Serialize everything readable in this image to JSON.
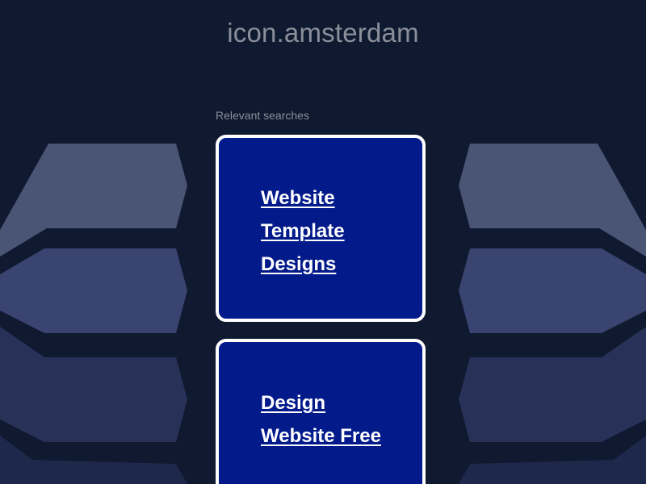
{
  "header": {
    "domain_title": "icon.amsterdam"
  },
  "main": {
    "relevant_label": "Relevant searches",
    "cards": [
      {
        "lines": [
          "Website",
          "Template",
          "Designs"
        ]
      },
      {
        "lines": [
          "Design",
          "Website Free"
        ]
      }
    ]
  },
  "colors": {
    "background": "#0f1930",
    "card_fill": "#021a8a",
    "card_border": "#ffffff",
    "muted_text": "#8a8f99",
    "shape_light": "#4a5474",
    "shape_mid": "#36406a",
    "shape_dark": "#232d52"
  }
}
